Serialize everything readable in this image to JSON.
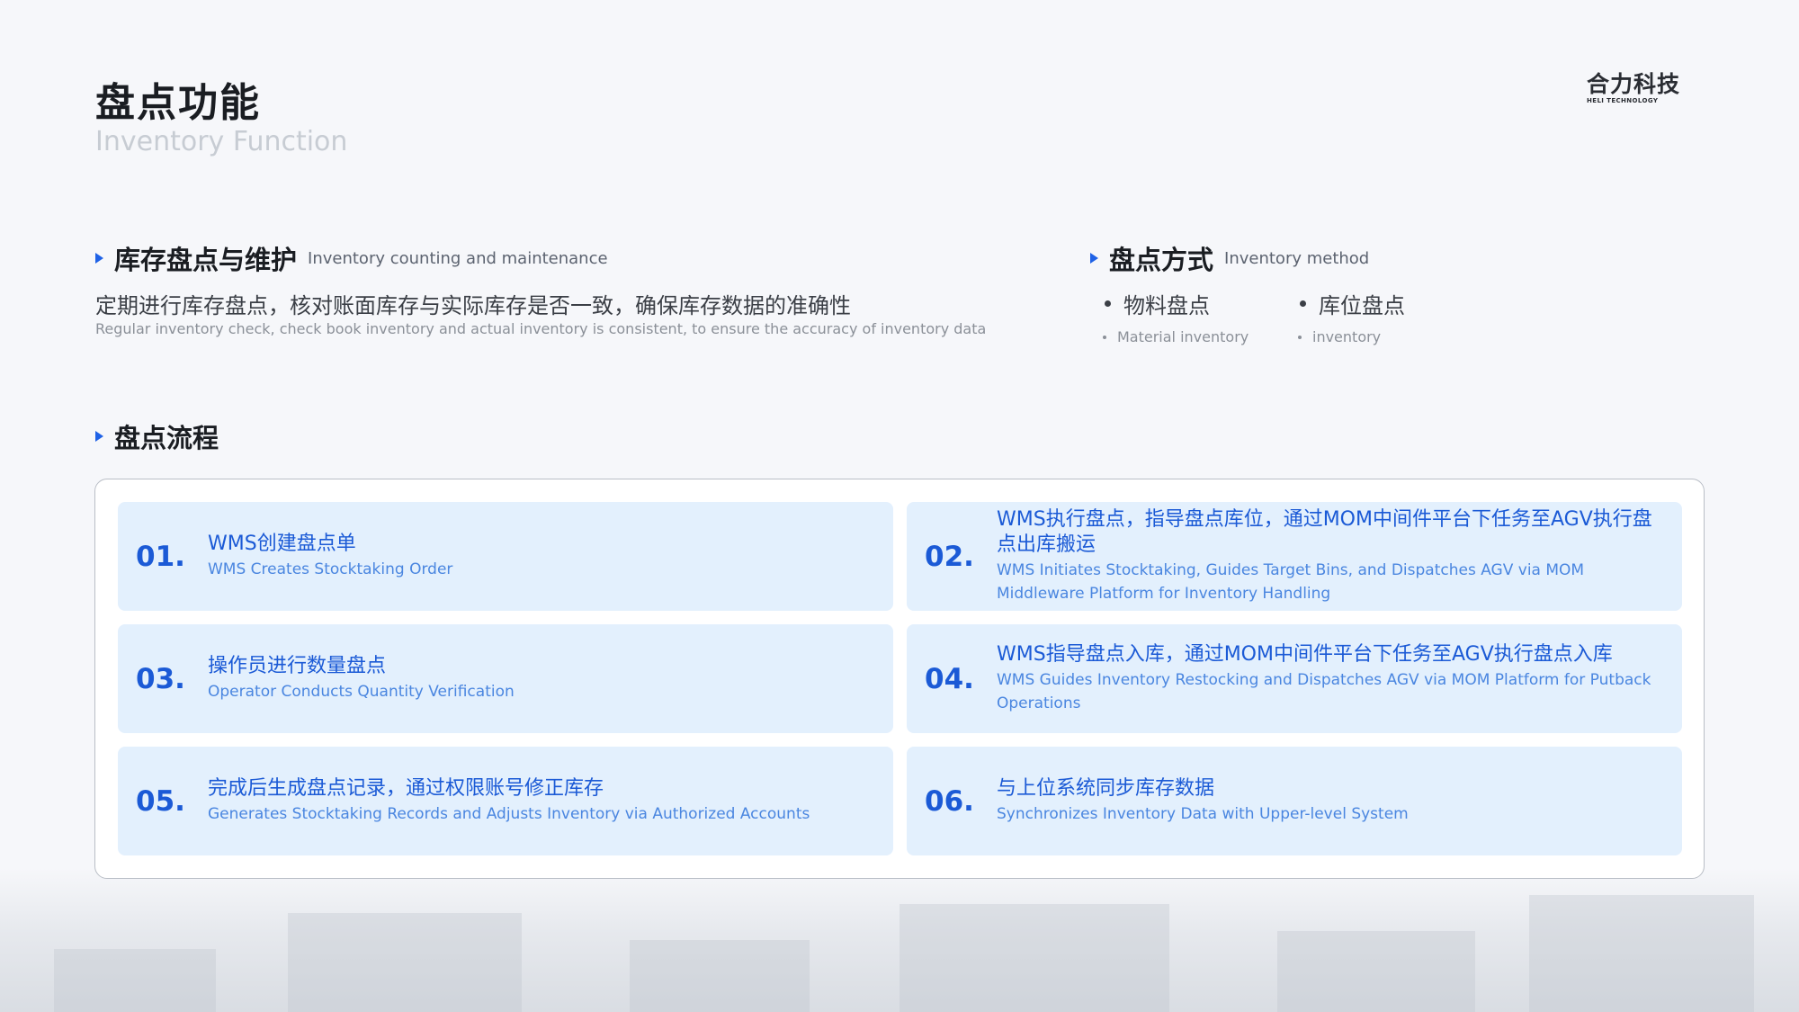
{
  "title": "盘点功能",
  "subtitle": "Inventory Function",
  "logo": {
    "cn": "合力科技",
    "en": "HELI TECHNOLOGY"
  },
  "section_counting": {
    "title_cn": "库存盘点与维护",
    "title_en": "Inventory counting and maintenance",
    "desc_cn": "定期进行库存盘点，核对账面库存与实际库存是否一致，确保库存数据的准确性",
    "desc_en": "Regular inventory check, check book inventory and actual inventory is consistent, to ensure the accuracy of inventory data"
  },
  "section_method": {
    "title_cn": "盘点方式",
    "title_en": "Inventory method",
    "items": [
      {
        "cn": "物料盘点",
        "en": "Material inventory"
      },
      {
        "cn": "库位盘点",
        "en": "inventory"
      }
    ]
  },
  "section_flow": {
    "title_cn": "盘点流程"
  },
  "steps": [
    {
      "num": "01.",
      "cn": "WMS创建盘点单",
      "en": "WMS Creates Stocktaking Order"
    },
    {
      "num": "02.",
      "cn": "WMS执行盘点，指导盘点库位，通过MOM中间件平台下任务至AGV执行盘点出库搬运",
      "en": "WMS Initiates Stocktaking, Guides Target Bins, and Dispatches AGV via MOM Middleware Platform for Inventory Handling"
    },
    {
      "num": "03.",
      "cn": "操作员进行数量盘点",
      "en": "Operator Conducts Quantity Verification"
    },
    {
      "num": "04.",
      "cn": "WMS指导盘点入库，通过MOM中间件平台下任务至AGV执行盘点入库",
      "en": "WMS Guides Inventory Restocking and Dispatches AGV via MOM Platform for Putback Operations"
    },
    {
      "num": "05.",
      "cn": "完成后生成盘点记录，通过权限账号修正库存",
      "en": "Generates Stocktaking Records and Adjusts Inventory via Authorized Accounts"
    },
    {
      "num": "06.",
      "cn": "与上位系统同步库存数据",
      "en": "Synchronizes Inventory Data with Upper-level System"
    }
  ],
  "colors": {
    "accent": "#1f62e6",
    "step_bg": "#e3f0fd",
    "step_text": "#1b5ad6"
  }
}
